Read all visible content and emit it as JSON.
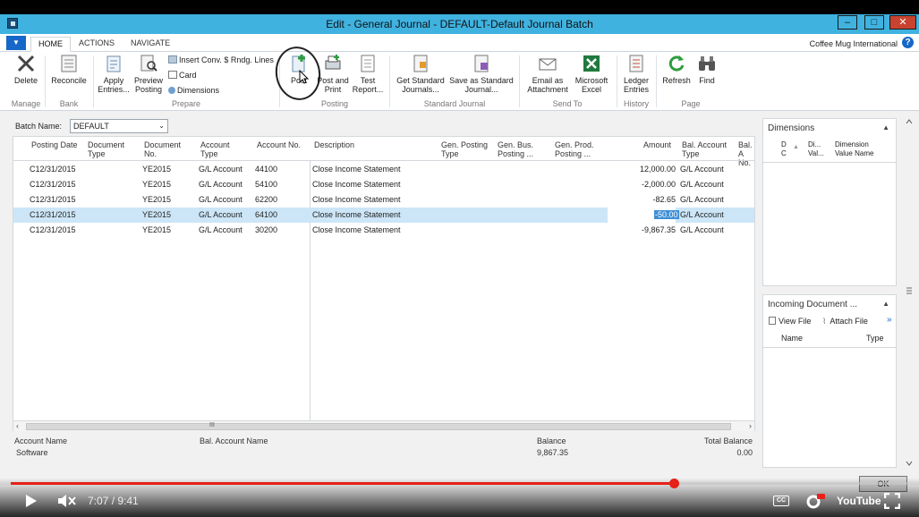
{
  "window": {
    "title": "Edit - General Journal - DEFAULT-Default Journal Batch"
  },
  "tabs": [
    {
      "label": "HOME"
    },
    {
      "label": "ACTIONS"
    },
    {
      "label": "NAVIGATE"
    }
  ],
  "company": "Coffee Mug International",
  "ribbon": {
    "delete": "Delete",
    "reconcile": "Reconcile",
    "apply_entries": [
      "Apply",
      "Entries..."
    ],
    "preview_posting": [
      "Preview",
      "Posting"
    ],
    "insert_conv": "Insert Conv. $ Rndg. Lines",
    "card": "Card",
    "dimensions": "Dimensions",
    "post": "Post",
    "post_and_print": [
      "Post and",
      "Print"
    ],
    "test_report": [
      "Test",
      "Report..."
    ],
    "get_standard": [
      "Get Standard",
      "Journals..."
    ],
    "save_standard": [
      "Save as Standard",
      "Journal..."
    ],
    "email_attachment": [
      "Email as",
      "Attachment"
    ],
    "excel": [
      "Microsoft",
      "Excel"
    ],
    "ledger_entries": [
      "Ledger",
      "Entries"
    ],
    "refresh": "Refresh",
    "find": "Find",
    "groups": {
      "manage": "Manage",
      "bank": "Bank",
      "prepare": "Prepare",
      "posting": "Posting",
      "standard_journal": "Standard Journal",
      "send_to": "Send To",
      "history": "History",
      "page": "Page"
    }
  },
  "batch": {
    "label": "Batch Name:",
    "value": "DEFAULT"
  },
  "grid": {
    "headers": {
      "posting_date": "Posting Date",
      "document_type": [
        "Document",
        "Type"
      ],
      "document_no": [
        "Document",
        "No."
      ],
      "account_type": [
        "Account",
        "Type"
      ],
      "account_no": "Account No.",
      "description": "Description",
      "gen_posting_type": [
        "Gen. Posting",
        "Type"
      ],
      "gen_bus_posting": [
        "Gen. Bus.",
        "Posting ..."
      ],
      "gen_prod_posting": [
        "Gen. Prod.",
        "Posting ..."
      ],
      "amount": "Amount",
      "bal_account_type": [
        "Bal. Account",
        "Type"
      ],
      "bal_account_no": [
        "Bal. A",
        "No."
      ]
    },
    "rows": [
      {
        "date": "C12/31/2015",
        "doc_no": "YE2015",
        "acc_type": "G/L Account",
        "acc_no": "44100",
        "desc": "Close Income Statement",
        "amount": "12,000.00",
        "bal_type": "G/L Account"
      },
      {
        "date": "C12/31/2015",
        "doc_no": "YE2015",
        "acc_type": "G/L Account",
        "acc_no": "54100",
        "desc": "Close Income Statement",
        "amount": "-2,000.00",
        "bal_type": "G/L Account"
      },
      {
        "date": "C12/31/2015",
        "doc_no": "YE2015",
        "acc_type": "G/L Account",
        "acc_no": "62200",
        "desc": "Close Income Statement",
        "amount": "-82.65",
        "bal_type": "G/L Account"
      },
      {
        "date": "C12/31/2015",
        "doc_no": "YE2015",
        "acc_type": "G/L Account",
        "acc_no": "64100",
        "desc": "Close Income Statement",
        "amount": "-50.00",
        "bal_type": "G/L Account"
      },
      {
        "date": "C12/31/2015",
        "doc_no": "YE2015",
        "acc_type": "G/L Account",
        "acc_no": "30200",
        "desc": "Close Income Statement",
        "amount": "-9,867.35",
        "bal_type": "G/L Account"
      }
    ],
    "scroll_thumb": "III"
  },
  "footer": {
    "account_name_label": "Account Name",
    "account_name_value": "Software",
    "bal_account_name_label": "Bal. Account Name",
    "balance_label": "Balance",
    "balance_value": "9,867.35",
    "total_balance_label": "Total Balance",
    "total_balance_value": "0.00"
  },
  "dimensions_pane": {
    "title": "Dimensions",
    "col1": [
      "D",
      "C"
    ],
    "col2": [
      "Di...",
      "Val..."
    ],
    "col3": [
      "Dimension",
      "Value Name"
    ]
  },
  "incoming_pane": {
    "title": "Incoming Document ...",
    "view_file": "View File",
    "attach_file": "Attach File",
    "more": "»",
    "col_name": "Name",
    "col_type": "Type"
  },
  "ok_label": "OK",
  "player": {
    "time": "7:07 / 9:41",
    "progress": 0.739,
    "youtube": "YouTube"
  }
}
